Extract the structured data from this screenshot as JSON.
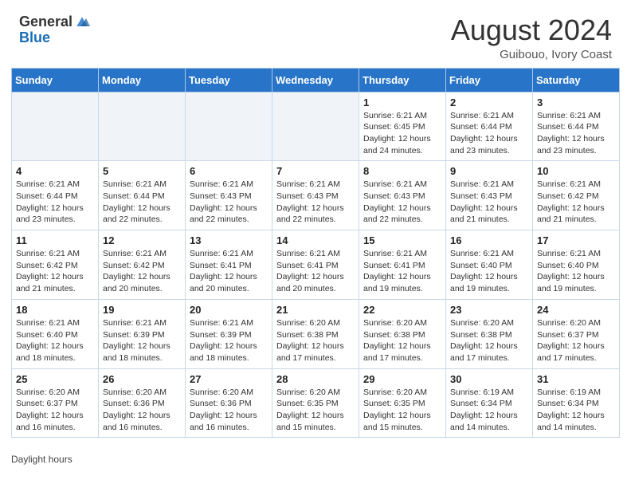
{
  "header": {
    "logo_general": "General",
    "logo_blue": "Blue",
    "month_title": "August 2024",
    "subtitle": "Guibouo, Ivory Coast"
  },
  "days_of_week": [
    "Sunday",
    "Monday",
    "Tuesday",
    "Wednesday",
    "Thursday",
    "Friday",
    "Saturday"
  ],
  "footer_label": "Daylight hours",
  "weeks": [
    [
      {
        "day": "",
        "info": ""
      },
      {
        "day": "",
        "info": ""
      },
      {
        "day": "",
        "info": ""
      },
      {
        "day": "",
        "info": ""
      },
      {
        "day": "1",
        "info": "Sunrise: 6:21 AM\nSunset: 6:45 PM\nDaylight: 12 hours\nand 24 minutes."
      },
      {
        "day": "2",
        "info": "Sunrise: 6:21 AM\nSunset: 6:44 PM\nDaylight: 12 hours\nand 23 minutes."
      },
      {
        "day": "3",
        "info": "Sunrise: 6:21 AM\nSunset: 6:44 PM\nDaylight: 12 hours\nand 23 minutes."
      }
    ],
    [
      {
        "day": "4",
        "info": "Sunrise: 6:21 AM\nSunset: 6:44 PM\nDaylight: 12 hours\nand 23 minutes."
      },
      {
        "day": "5",
        "info": "Sunrise: 6:21 AM\nSunset: 6:44 PM\nDaylight: 12 hours\nand 22 minutes."
      },
      {
        "day": "6",
        "info": "Sunrise: 6:21 AM\nSunset: 6:43 PM\nDaylight: 12 hours\nand 22 minutes."
      },
      {
        "day": "7",
        "info": "Sunrise: 6:21 AM\nSunset: 6:43 PM\nDaylight: 12 hours\nand 22 minutes."
      },
      {
        "day": "8",
        "info": "Sunrise: 6:21 AM\nSunset: 6:43 PM\nDaylight: 12 hours\nand 22 minutes."
      },
      {
        "day": "9",
        "info": "Sunrise: 6:21 AM\nSunset: 6:43 PM\nDaylight: 12 hours\nand 21 minutes."
      },
      {
        "day": "10",
        "info": "Sunrise: 6:21 AM\nSunset: 6:42 PM\nDaylight: 12 hours\nand 21 minutes."
      }
    ],
    [
      {
        "day": "11",
        "info": "Sunrise: 6:21 AM\nSunset: 6:42 PM\nDaylight: 12 hours\nand 21 minutes."
      },
      {
        "day": "12",
        "info": "Sunrise: 6:21 AM\nSunset: 6:42 PM\nDaylight: 12 hours\nand 20 minutes."
      },
      {
        "day": "13",
        "info": "Sunrise: 6:21 AM\nSunset: 6:41 PM\nDaylight: 12 hours\nand 20 minutes."
      },
      {
        "day": "14",
        "info": "Sunrise: 6:21 AM\nSunset: 6:41 PM\nDaylight: 12 hours\nand 20 minutes."
      },
      {
        "day": "15",
        "info": "Sunrise: 6:21 AM\nSunset: 6:41 PM\nDaylight: 12 hours\nand 19 minutes."
      },
      {
        "day": "16",
        "info": "Sunrise: 6:21 AM\nSunset: 6:40 PM\nDaylight: 12 hours\nand 19 minutes."
      },
      {
        "day": "17",
        "info": "Sunrise: 6:21 AM\nSunset: 6:40 PM\nDaylight: 12 hours\nand 19 minutes."
      }
    ],
    [
      {
        "day": "18",
        "info": "Sunrise: 6:21 AM\nSunset: 6:40 PM\nDaylight: 12 hours\nand 18 minutes."
      },
      {
        "day": "19",
        "info": "Sunrise: 6:21 AM\nSunset: 6:39 PM\nDaylight: 12 hours\nand 18 minutes."
      },
      {
        "day": "20",
        "info": "Sunrise: 6:21 AM\nSunset: 6:39 PM\nDaylight: 12 hours\nand 18 minutes."
      },
      {
        "day": "21",
        "info": "Sunrise: 6:20 AM\nSunset: 6:38 PM\nDaylight: 12 hours\nand 17 minutes."
      },
      {
        "day": "22",
        "info": "Sunrise: 6:20 AM\nSunset: 6:38 PM\nDaylight: 12 hours\nand 17 minutes."
      },
      {
        "day": "23",
        "info": "Sunrise: 6:20 AM\nSunset: 6:38 PM\nDaylight: 12 hours\nand 17 minutes."
      },
      {
        "day": "24",
        "info": "Sunrise: 6:20 AM\nSunset: 6:37 PM\nDaylight: 12 hours\nand 17 minutes."
      }
    ],
    [
      {
        "day": "25",
        "info": "Sunrise: 6:20 AM\nSunset: 6:37 PM\nDaylight: 12 hours\nand 16 minutes."
      },
      {
        "day": "26",
        "info": "Sunrise: 6:20 AM\nSunset: 6:36 PM\nDaylight: 12 hours\nand 16 minutes."
      },
      {
        "day": "27",
        "info": "Sunrise: 6:20 AM\nSunset: 6:36 PM\nDaylight: 12 hours\nand 16 minutes."
      },
      {
        "day": "28",
        "info": "Sunrise: 6:20 AM\nSunset: 6:35 PM\nDaylight: 12 hours\nand 15 minutes."
      },
      {
        "day": "29",
        "info": "Sunrise: 6:20 AM\nSunset: 6:35 PM\nDaylight: 12 hours\nand 15 minutes."
      },
      {
        "day": "30",
        "info": "Sunrise: 6:19 AM\nSunset: 6:34 PM\nDaylight: 12 hours\nand 14 minutes."
      },
      {
        "day": "31",
        "info": "Sunrise: 6:19 AM\nSunset: 6:34 PM\nDaylight: 12 hours\nand 14 minutes."
      }
    ]
  ]
}
